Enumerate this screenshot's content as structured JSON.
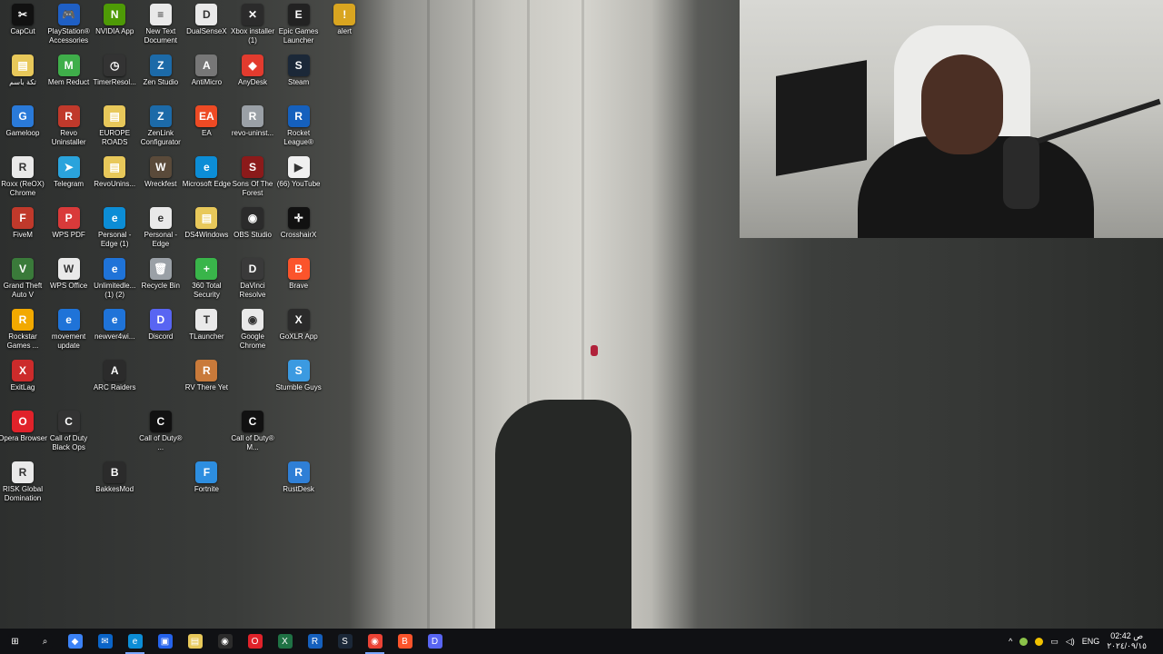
{
  "desktop": {
    "icons": [
      {
        "label": "CapCut",
        "color": "#111111",
        "glyph": "✂"
      },
      {
        "label": "PlayStation® Accessories",
        "color": "#1f5fc4",
        "glyph": "🎮"
      },
      {
        "label": "NVIDIA App",
        "color": "#4e9a06",
        "glyph": "N"
      },
      {
        "label": "New Text Document",
        "color": "#e9e9e9",
        "glyph": "≡"
      },
      {
        "label": "DualSenseX",
        "color": "#e9e9e9",
        "glyph": "D"
      },
      {
        "label": "Xbox installer (1)",
        "color": "#2b2b2b",
        "glyph": "✕"
      },
      {
        "label": "Epic Games Launcher",
        "color": "#222222",
        "glyph": "E"
      },
      {
        "label": "alert",
        "color": "#d9a520",
        "glyph": "!"
      },
      {
        "label": "تكة باسم",
        "color": "#e8c85a",
        "glyph": "▤"
      },
      {
        "label": "Mem Reduct",
        "color": "#3fae4a",
        "glyph": "M"
      },
      {
        "label": "TimerResol...",
        "color": "#333333",
        "glyph": "◷"
      },
      {
        "label": "Zen Studio",
        "color": "#1c6aa8",
        "glyph": "Z"
      },
      {
        "label": "AntiMicro",
        "color": "#777777",
        "glyph": "A"
      },
      {
        "label": "AnyDesk",
        "color": "#e23b2e",
        "glyph": "◆"
      },
      {
        "label": "Steam",
        "color": "#1b2838",
        "glyph": "S"
      },
      {
        "label": "Gameloop",
        "color": "#2a7ad9",
        "glyph": "G"
      },
      {
        "label": "Revo Uninstaller",
        "color": "#c0392b",
        "glyph": "R"
      },
      {
        "label": "EUROPE ROADS",
        "color": "#e8c85a",
        "glyph": "▤"
      },
      {
        "label": "ZenLink Configurator",
        "color": "#1c6aa8",
        "glyph": "Z"
      },
      {
        "label": "EA",
        "color": "#ee4a24",
        "glyph": "EA"
      },
      {
        "label": "revo-uninst...",
        "color": "#9aa0a6",
        "glyph": "R"
      },
      {
        "label": "Rocket League®",
        "color": "#1560bd",
        "glyph": "R"
      },
      {
        "label": "Roxx (ReOX) Chrome",
        "color": "#e9e9e9",
        "glyph": "R"
      },
      {
        "label": "Telegram",
        "color": "#2aa3dc",
        "glyph": "➤"
      },
      {
        "label": "RevoUnins...",
        "color": "#e8c85a",
        "glyph": "▤"
      },
      {
        "label": "Wreckfest",
        "color": "#5a4a3a",
        "glyph": "W"
      },
      {
        "label": "Microsoft Edge",
        "color": "#0c8dd6",
        "glyph": "e"
      },
      {
        "label": "Sons Of The Forest",
        "color": "#8b1a1a",
        "glyph": "S"
      },
      {
        "label": "(66) YouTube",
        "color": "#f0f0f0",
        "glyph": "▶"
      },
      {
        "label": "FiveM",
        "color": "#c0392b",
        "glyph": "F"
      },
      {
        "label": "WPS PDF",
        "color": "#d93a3a",
        "glyph": "P"
      },
      {
        "label": "Personal - Edge (1)",
        "color": "#0c8dd6",
        "glyph": "e"
      },
      {
        "label": "Personal - Edge",
        "color": "#e9e9e9",
        "glyph": "e"
      },
      {
        "label": "DS4Windows",
        "color": "#e8c85a",
        "glyph": "▤"
      },
      {
        "label": "OBS Studio",
        "color": "#2b2b2b",
        "glyph": "◉"
      },
      {
        "label": "CrosshairX",
        "color": "#111111",
        "glyph": "✛"
      },
      {
        "label": "Grand Theft Auto V",
        "color": "#3a7a3a",
        "glyph": "V"
      },
      {
        "label": "WPS Office",
        "color": "#e9e9e9",
        "glyph": "W"
      },
      {
        "label": "Unlimitedle... (1) (2)",
        "color": "#1f73d8",
        "glyph": "e"
      },
      {
        "label": "Recycle Bin",
        "color": "#9aa0a6",
        "glyph": "🗑"
      },
      {
        "label": "360 Total Security",
        "color": "#39b54a",
        "glyph": "+"
      },
      {
        "label": "DaVinci Resolve",
        "color": "#3a3a3a",
        "glyph": "D"
      },
      {
        "label": "Brave",
        "color": "#fb542b",
        "glyph": "B"
      },
      {
        "label": "Rockstar Games ...",
        "color": "#f2a900",
        "glyph": "R"
      },
      {
        "label": "movement update",
        "color": "#1f73d8",
        "glyph": "e"
      },
      {
        "label": "newver4wi...",
        "color": "#1f73d8",
        "glyph": "e"
      },
      {
        "label": "Discord",
        "color": "#5865f2",
        "glyph": "D"
      },
      {
        "label": "TLauncher",
        "color": "#e9e9e9",
        "glyph": "T"
      },
      {
        "label": "Google Chrome",
        "color": "#e9e9e9",
        "glyph": "◉"
      },
      {
        "label": "GoXLR App",
        "color": "#2b2b2b",
        "glyph": "X"
      },
      {
        "label": "ExitLag",
        "color": "#cc2b2b",
        "glyph": "X"
      },
      {
        "label": "ARC Raiders",
        "color": "#2b2b2b",
        "glyph": "A"
      },
      {
        "label": "RV There Yet",
        "color": "#c97a3a",
        "glyph": "R"
      },
      {
        "label": "Stumble Guys",
        "color": "#3b9ae1",
        "glyph": "S"
      },
      {
        "label": "Opera Browser",
        "color": "#e0222a",
        "glyph": "O"
      },
      {
        "label": "Call of Duty Black Ops",
        "color": "#333333",
        "glyph": "C"
      },
      {
        "label": "Call of Duty® ...",
        "color": "#111111",
        "glyph": "C"
      },
      {
        "label": "Call of Duty® M...",
        "color": "#111111",
        "glyph": "C"
      },
      {
        "label": "RISK Global Domination",
        "color": "#e9e9e9",
        "glyph": "R"
      },
      {
        "label": "BakkesMod",
        "color": "#2b2b2b",
        "glyph": "B"
      },
      {
        "label": "Fortnite",
        "color": "#2d8ee0",
        "glyph": "F"
      },
      {
        "label": "RustDesk",
        "color": "#2f7fd6",
        "glyph": "R"
      }
    ]
  },
  "taskbar": {
    "items": [
      {
        "name": "start-button",
        "glyph": "⊞",
        "color": "#101114"
      },
      {
        "name": "search-icon",
        "glyph": "⌕",
        "color": "#101114"
      },
      {
        "name": "copilot-icon",
        "glyph": "◆",
        "color": "#3b82f6"
      },
      {
        "name": "outlook-icon",
        "glyph": "✉",
        "color": "#0a64c8"
      },
      {
        "name": "edge-icon",
        "glyph": "e",
        "color": "#0c8dd6"
      },
      {
        "name": "store-icon",
        "glyph": "▣",
        "color": "#2563eb"
      },
      {
        "name": "file-explorer-icon",
        "glyph": "▤",
        "color": "#e8c85a"
      },
      {
        "name": "obs-icon",
        "glyph": "◉",
        "color": "#2b2b2b"
      },
      {
        "name": "opera-icon",
        "glyph": "O",
        "color": "#e0222a"
      },
      {
        "name": "excel-icon",
        "glyph": "X",
        "color": "#1f7244"
      },
      {
        "name": "rocket-league-icon",
        "glyph": "R",
        "color": "#1560bd"
      },
      {
        "name": "steam-icon",
        "glyph": "S",
        "color": "#1b2838"
      },
      {
        "name": "chrome-icon",
        "glyph": "◉",
        "color": "#ea4335"
      },
      {
        "name": "brave-icon",
        "glyph": "B",
        "color": "#fb542b"
      },
      {
        "name": "discord-icon",
        "glyph": "D",
        "color": "#5865f2"
      }
    ],
    "tray": {
      "chevron": "^",
      "language": "ENG",
      "time": "ص 02:42",
      "date": "٢٠٢٤/٠٩/١٥"
    }
  }
}
